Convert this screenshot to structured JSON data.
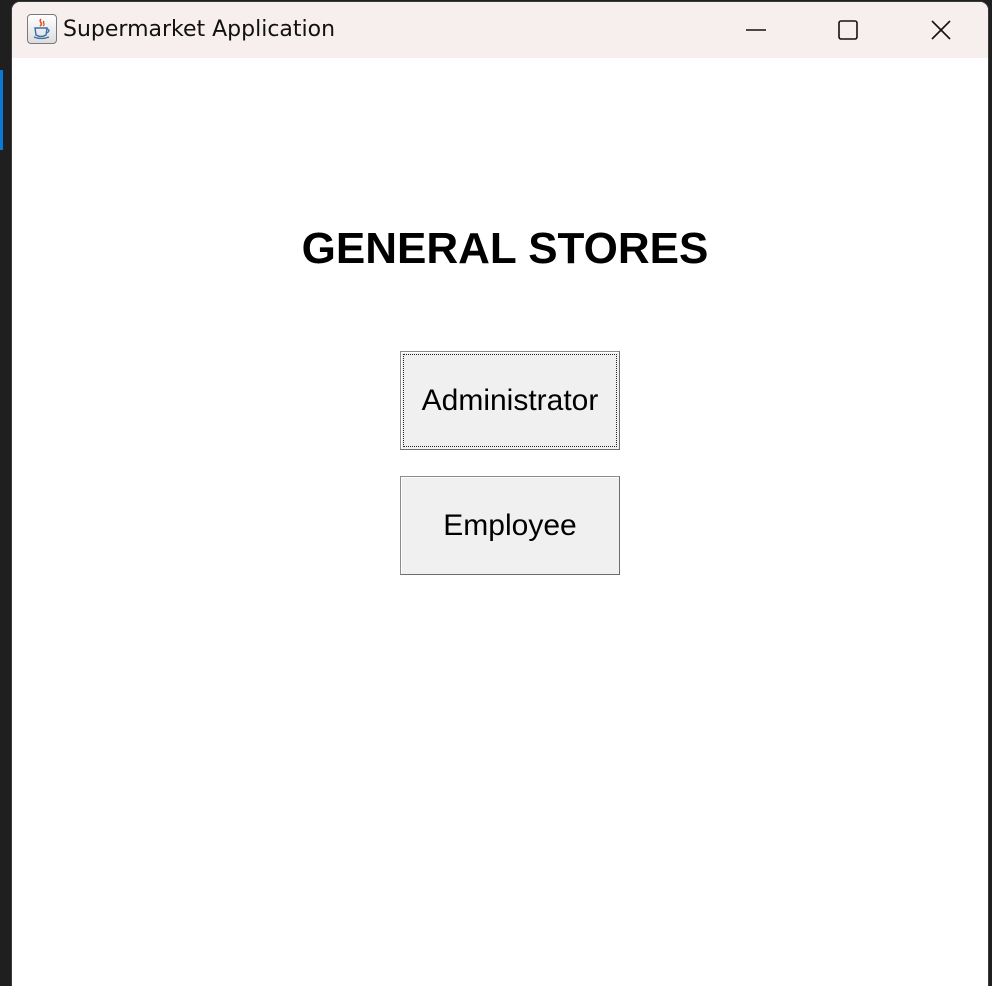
{
  "window": {
    "title": "Supermarket Application",
    "icon": "java-coffee-cup-icon",
    "controls": [
      "minimize-icon",
      "maximize-icon",
      "close-icon"
    ]
  },
  "main": {
    "heading": "GENERAL STORES",
    "buttons": {
      "administrator": "Administrator",
      "employee": "Employee"
    },
    "focused_button": "Administrator"
  },
  "colors": {
    "titlebar_bg": "#f7eeee",
    "content_bg": "#ffffff",
    "button_bg": "#f0f0f0",
    "accent": "#0a78d4"
  }
}
